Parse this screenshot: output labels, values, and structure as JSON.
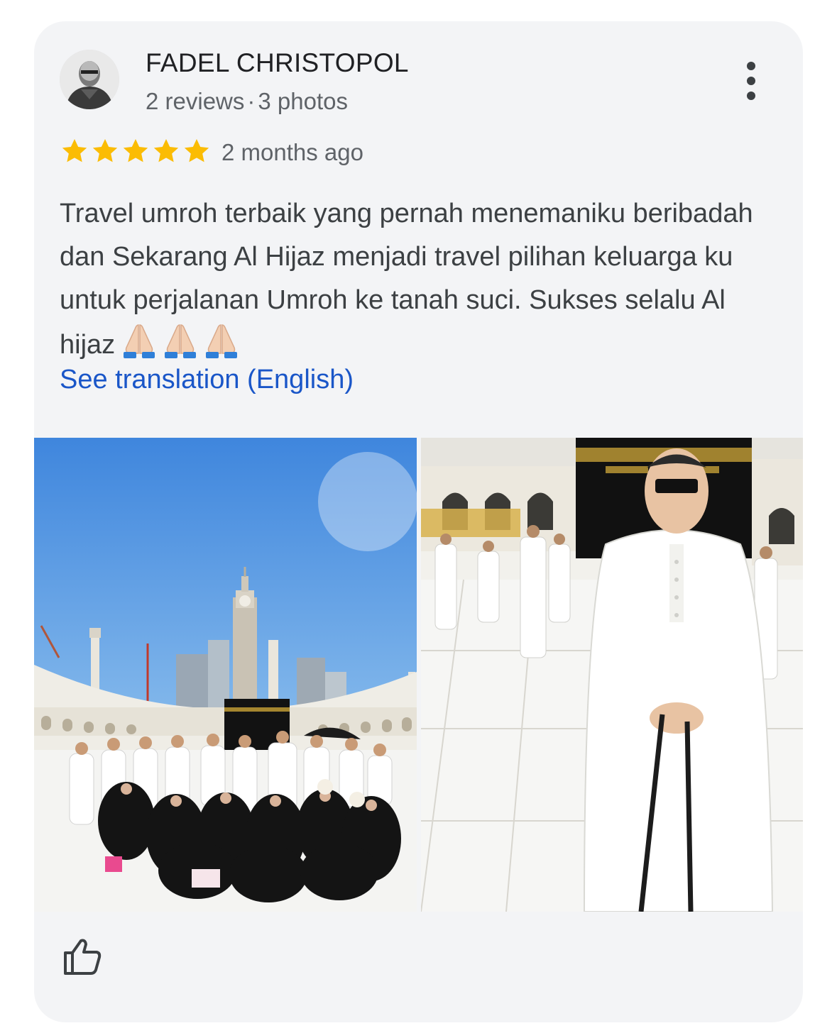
{
  "review": {
    "author": {
      "name": "FADEL CHRISTOPOL",
      "reviews": "2 reviews",
      "photos": "3 photos",
      "separator": "·"
    },
    "rating": 5,
    "time_ago": "2 months ago",
    "text": "Travel umroh terbaik yang pernah menemaniku beribadah dan Sekarang Al Hijaz menjadi travel pilihan keluarga ku untuk perjalanan Umroh ke tanah suci. Sukses selalu Al hijaz",
    "emoji": "🙏🏻🙏🏻🙏🏻",
    "see_translation": "See translation (English)"
  },
  "colors": {
    "card_bg": "#f3f4f6",
    "star": "#fbbc04",
    "link": "#1a56c8",
    "name": "#202124",
    "secondary": "#5f6368"
  },
  "icons": [
    "more-vert-icon",
    "star-icon",
    "thumb-up-icon",
    "folded-hands-emoji"
  ]
}
